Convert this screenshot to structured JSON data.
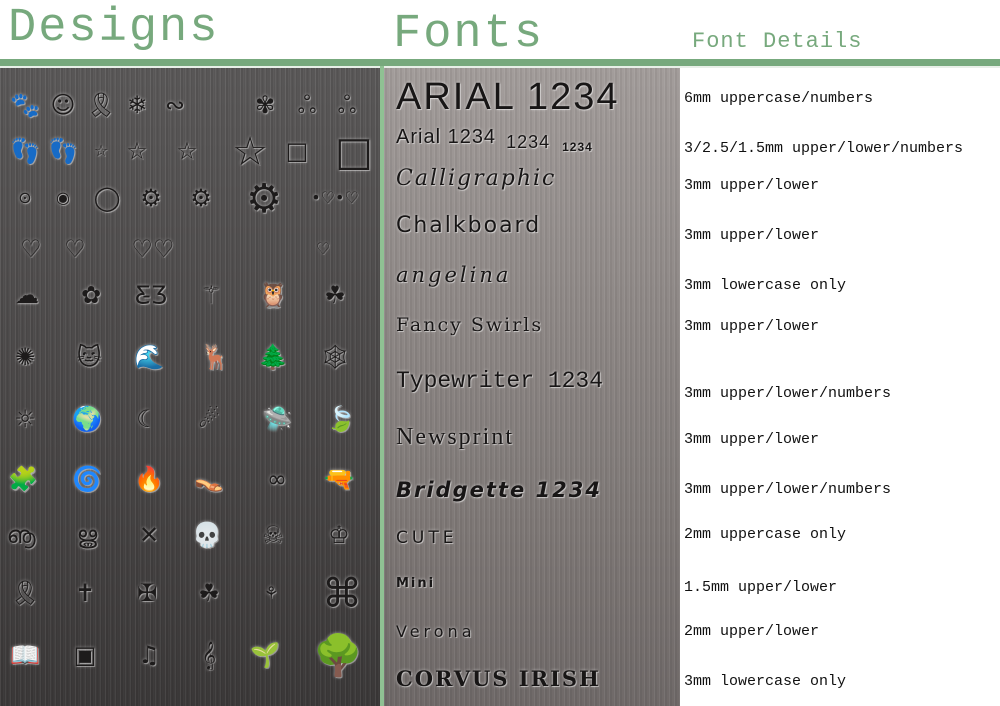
{
  "headings": {
    "designs": "Designs",
    "fonts": "Fonts",
    "font_details": "Font Details"
  },
  "colors": {
    "accent_green": "#77a97d",
    "separator_green": "#8fc193"
  },
  "designs": {
    "rows": [
      [
        "paw-print",
        "smiley-face",
        "awareness-ribbon",
        "snowflake",
        "swirl",
        "atom-flower",
        "small-triskele",
        "large-triskele"
      ],
      [
        "left-foot",
        "right-foot",
        "tiny-star",
        "small-star",
        "medium-star",
        "large-star",
        "small-square",
        "large-square"
      ],
      [
        "tiny-circle",
        "small-circle",
        "large-circle",
        "small-gear",
        "medium-gear",
        "large-gear",
        "heart-chain"
      ],
      [
        "heart",
        "swirl-heart",
        "double-heart",
        "small-heart"
      ],
      [
        "cloud",
        "flower",
        "butterfly",
        "dragonfly",
        "owl",
        "four-leaf-clover"
      ],
      [
        "fireworks",
        "cat-face",
        "wave",
        "moose",
        "pine-tree",
        "spider-web"
      ],
      [
        "sun",
        "earth-globe",
        "crescent-moon",
        "shooting-star",
        "ufo",
        "leaf"
      ],
      [
        "puzzle-piece",
        "spiral",
        "flame",
        "flip-flops",
        "infinity",
        "revolver"
      ],
      [
        "swirl-cloud",
        "swirl-vine",
        "crossbones",
        "skull",
        "skull-and-crossbones",
        "crown"
      ],
      [
        "ribbon",
        "cross",
        "celtic-cross",
        "triquetra",
        "small-triquetra",
        "celtic-knot"
      ],
      [
        "open-book",
        "greek-key",
        "music-notes",
        "treble-clef",
        "small-tree",
        "large-tree"
      ]
    ],
    "glyphs": {
      "paw-print": "🐾",
      "smiley-face": "☺",
      "awareness-ribbon": "🎗",
      "snowflake": "❄",
      "swirl": "∾",
      "atom-flower": "✾",
      "small-triskele": "ஃ",
      "large-triskele": "ஃ",
      "left-foot": "👣",
      "right-foot": "👣",
      "tiny-star": "☆",
      "small-star": "☆",
      "medium-star": "☆",
      "large-star": "☆",
      "small-square": "□",
      "large-square": "□",
      "tiny-circle": "⊙",
      "small-circle": "◉",
      "large-circle": "◯",
      "small-gear": "⚙",
      "medium-gear": "⚙",
      "large-gear": "⚙",
      "heart-chain": "•♡•♡",
      "heart": "♡",
      "swirl-heart": "♡",
      "double-heart": "♡♡",
      "small-heart": "♡",
      "cloud": "☁",
      "flower": "✿",
      "butterfly": "Ƹ̵Ʒ",
      "dragonfly": "⚚",
      "owl": "🦉",
      "four-leaf-clover": "☘",
      "fireworks": "✺",
      "cat-face": "🐱",
      "wave": "🌊",
      "moose": "🦌",
      "pine-tree": "🌲",
      "spider-web": "🕸",
      "sun": "☼",
      "earth-globe": "🌍",
      "crescent-moon": "☾",
      "shooting-star": "☄",
      "ufo": "🛸",
      "leaf": "🍃",
      "puzzle-piece": "🧩",
      "spiral": "🌀",
      "flame": "🔥",
      "flip-flops": "👡",
      "infinity": "∞",
      "revolver": "🔫",
      "swirl-cloud": "ൡ",
      "swirl-vine": "ൠ",
      "crossbones": "✕",
      "skull": "💀",
      "skull-and-crossbones": "☠",
      "crown": "♔",
      "ribbon": "🎗",
      "cross": "✝",
      "celtic-cross": "✠",
      "triquetra": "☘",
      "small-triquetra": "⚘",
      "celtic-knot": "⌘",
      "open-book": "📖",
      "greek-key": "▣",
      "music-notes": "♫",
      "treble-clef": "𝄞",
      "small-tree": "🌱",
      "large-tree": "🌳"
    }
  },
  "fonts": [
    {
      "name": "ARIAL",
      "sample": "ARIAL 1234",
      "detail": "6mm uppercase/numbers"
    },
    {
      "name": "Arial",
      "sample": "Arial 1234",
      "sample_2": "1234",
      "sample_3": "1234",
      "detail": "3/2.5/1.5mm upper/lower/numbers"
    },
    {
      "name": "Calligraphic",
      "sample": "Calligraphic",
      "detail": "3mm upper/lower"
    },
    {
      "name": "Chalkboard",
      "sample": "Chalkboard",
      "detail": "3mm upper/lower"
    },
    {
      "name": "angelina",
      "sample": "angelina",
      "detail": "3mm lowercase only"
    },
    {
      "name": "Fancy Swirls",
      "sample": "Fancy Swirls",
      "detail": "3mm upper/lower"
    },
    {
      "name": "Typewriter",
      "sample": "Typewriter 1234",
      "detail": "3mm upper/lower/numbers"
    },
    {
      "name": "Newsprint",
      "sample": "Newsprint",
      "detail": "3mm upper/lower"
    },
    {
      "name": "Bridgette",
      "sample": "Bridgette 1234",
      "detail": "3mm upper/lower/numbers"
    },
    {
      "name": "CUTE",
      "sample": "CUTE",
      "detail": "2mm uppercase only"
    },
    {
      "name": "Mini",
      "sample": "Mini",
      "detail": "1.5mm upper/lower"
    },
    {
      "name": "Verona",
      "sample": "Verona",
      "detail": "2mm upper/lower"
    },
    {
      "name": "corvus irish",
      "sample": "CORVUS IRISH",
      "detail": "3mm lowercase only"
    }
  ]
}
